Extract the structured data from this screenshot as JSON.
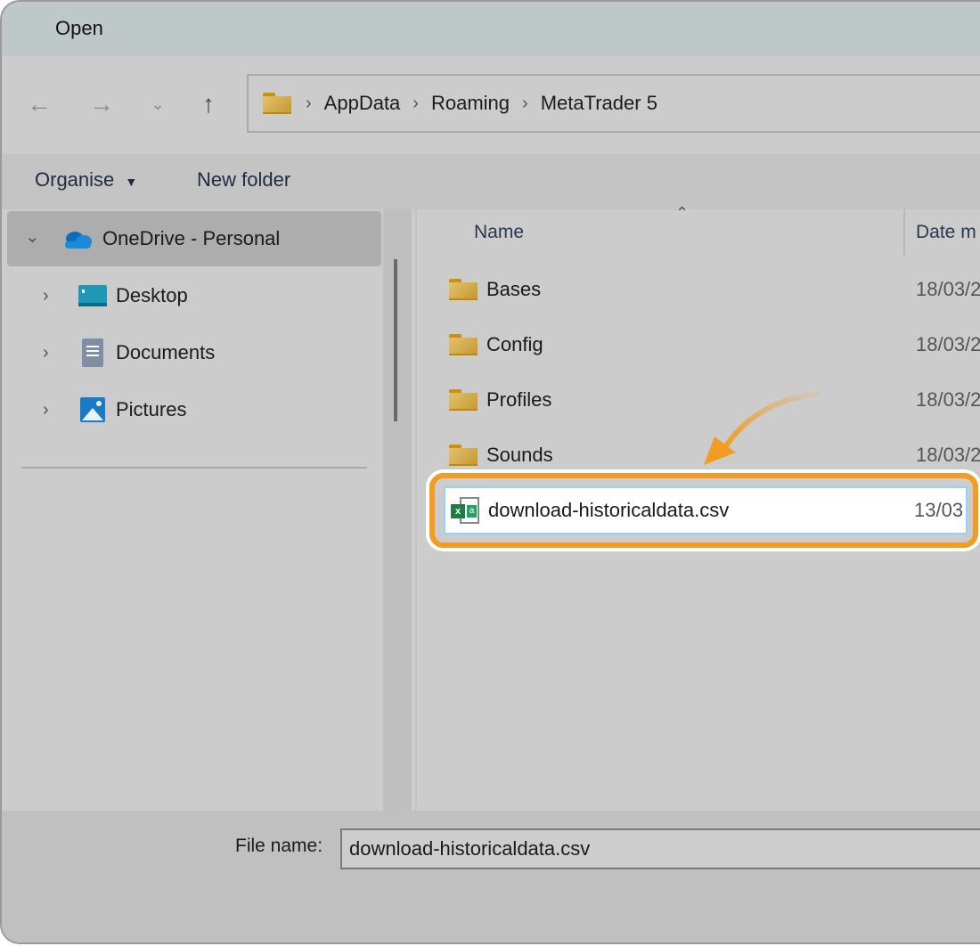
{
  "window": {
    "title": "Open"
  },
  "nav": {
    "back_icon": "arrow-left-icon",
    "forward_icon": "arrow-right-icon",
    "recent_icon": "chevron-down-icon",
    "up_icon": "arrow-up-icon",
    "breadcrumb": [
      "AppData",
      "Roaming",
      "MetaTrader 5"
    ]
  },
  "toolbar": {
    "organise_label": "Organise",
    "new_folder_label": "New folder"
  },
  "sidebar": {
    "items": [
      {
        "label": "OneDrive - Personal",
        "icon": "onedrive-cloud-icon",
        "expanded": true,
        "selected": true
      },
      {
        "label": "Desktop",
        "icon": "desktop-icon",
        "expanded": false
      },
      {
        "label": "Documents",
        "icon": "documents-icon",
        "expanded": false
      },
      {
        "label": "Pictures",
        "icon": "pictures-icon",
        "expanded": false
      }
    ]
  },
  "list": {
    "columns": {
      "name": "Name",
      "date": "Date m"
    },
    "rows": [
      {
        "name": "Bases",
        "date": "18/03/2",
        "type": "folder"
      },
      {
        "name": "Config",
        "date": "18/03/2",
        "type": "folder"
      },
      {
        "name": "Profiles",
        "date": "18/03/2",
        "type": "folder"
      },
      {
        "name": "Sounds",
        "date": "18/03/2",
        "type": "folder"
      },
      {
        "name": "download-historicaldata.csv",
        "date": "13/03",
        "type": "csv",
        "selected": true
      }
    ]
  },
  "annotation": {
    "highlight_color": "#f39c23",
    "selection_border": "#99d1f5"
  },
  "footer": {
    "file_name_label": "File name:",
    "file_name_value": "download-historicaldata.csv"
  }
}
